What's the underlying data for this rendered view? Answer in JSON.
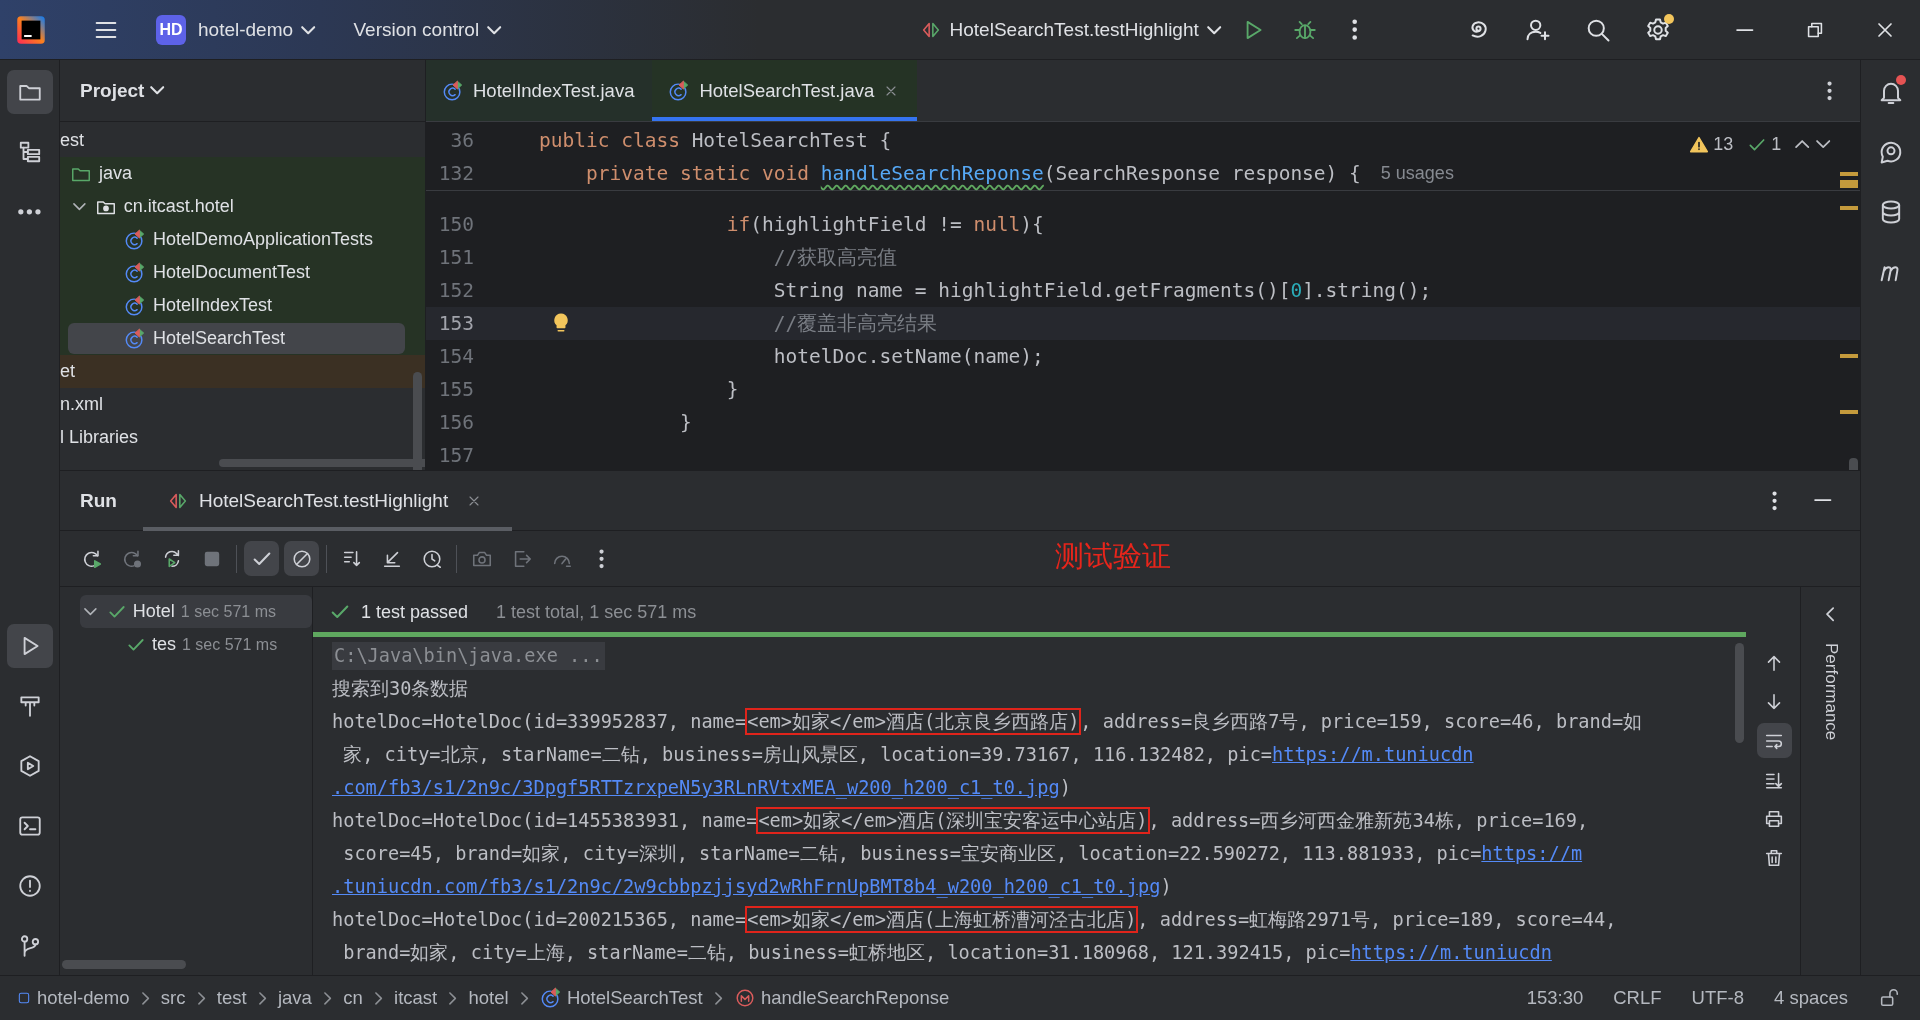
{
  "title_bar": {
    "project_badge": "HD",
    "project": "hotel-demo",
    "vcs": "Version control",
    "run_config": "HotelSearchTest.testHighlight",
    "settings_notice": true
  },
  "tool_strip_left": {
    "top": [
      {
        "kind": "project",
        "selected": true
      },
      {
        "kind": "structure",
        "selected": false
      },
      {
        "kind": "more",
        "selected": false
      }
    ],
    "bottom": [
      {
        "kind": "run",
        "selected": true
      },
      {
        "kind": "build",
        "selected": false
      },
      {
        "kind": "services",
        "selected": false
      },
      {
        "kind": "terminal",
        "selected": false
      },
      {
        "kind": "problems",
        "selected": false
      },
      {
        "kind": "git",
        "selected": false
      }
    ]
  },
  "tool_strip_right": [
    {
      "kind": "notifications",
      "unread": true
    },
    {
      "kind": "ai-chat",
      "unread": false
    },
    {
      "kind": "database",
      "unread": false
    },
    {
      "kind": "maven",
      "unread": false
    }
  ],
  "project_panel": {
    "title": "Project",
    "tree": [
      {
        "label": "est",
        "test_scope": false,
        "excluded": false,
        "selected": false,
        "children": [
          {
            "label": "java",
            "kind": "source-folder",
            "test_scope": true,
            "excluded": false,
            "selected": false,
            "children": [
              {
                "label": "cn.itcast.hotel",
                "kind": "package",
                "expanded": true,
                "test_scope": true,
                "excluded": false,
                "selected": false,
                "children": [
                  {
                    "label": "HotelDemoApplicationTests",
                    "kind": "test-class",
                    "test_scope": true,
                    "excluded": false,
                    "selected": false
                  },
                  {
                    "label": "HotelDocumentTest",
                    "kind": "test-class",
                    "test_scope": true,
                    "excluded": false,
                    "selected": false
                  },
                  {
                    "label": "HotelIndexTest",
                    "kind": "test-class",
                    "test_scope": true,
                    "excluded": false,
                    "selected": false
                  },
                  {
                    "label": "HotelSearchTest",
                    "kind": "test-class",
                    "test_scope": true,
                    "excluded": false,
                    "selected": true
                  }
                ]
              }
            ]
          }
        ]
      },
      {
        "label": "et",
        "test_scope": false,
        "excluded": true,
        "selected": false
      },
      {
        "label": "n.xml",
        "test_scope": false,
        "excluded": false,
        "selected": false
      },
      {
        "label": "l Libraries",
        "test_scope": false,
        "excluded": false,
        "selected": false
      }
    ]
  },
  "editor": {
    "tabs": [
      {
        "label": "HotelIndexTest.java",
        "selected": false
      },
      {
        "label": "HotelSearchTest.java",
        "selected": true
      }
    ],
    "inspections": {
      "warnings": "13",
      "passed": "1"
    },
    "sticky_lines": [
      {
        "number": "36",
        "tokens": [
          {
            "kind": "keyword",
            "text": "public class "
          },
          {
            "kind": "plain",
            "text": "HotelSearchTest {"
          }
        ]
      },
      {
        "number": "132",
        "tokens": [
          {
            "kind": "keyword",
            "text": "    private static void "
          },
          {
            "kind": "misspelled-method",
            "text": "handleSearchReponse"
          },
          {
            "kind": "plain",
            "text": "(SearchResponse response) {"
          }
        ],
        "hint": "5 usages"
      }
    ],
    "lines": [
      {
        "number": "150",
        "current": false,
        "tokens": [
          {
            "kind": "keyword",
            "text": "                if"
          },
          {
            "kind": "plain",
            "text": "(highlightField != "
          },
          {
            "kind": "keyword",
            "text": "null"
          },
          {
            "kind": "plain",
            "text": "){"
          }
        ]
      },
      {
        "number": "151",
        "current": false,
        "tokens": [
          {
            "kind": "comment",
            "text": "                    //获取高亮值"
          }
        ]
      },
      {
        "number": "152",
        "current": false,
        "tokens": [
          {
            "kind": "plain",
            "text": "                    String name = highlightField.getFragments()["
          },
          {
            "kind": "number",
            "text": "0"
          },
          {
            "kind": "plain",
            "text": "].string();"
          }
        ]
      },
      {
        "number": "153",
        "current": true,
        "tokens": [
          {
            "kind": "comment",
            "text": "                    //覆盖非高亮结果"
          }
        ]
      },
      {
        "number": "154",
        "current": false,
        "tokens": [
          {
            "kind": "plain",
            "text": "                    hotelDoc.setName(name);"
          }
        ]
      },
      {
        "number": "155",
        "current": false,
        "tokens": [
          {
            "kind": "plain",
            "text": "                }"
          }
        ]
      },
      {
        "number": "156",
        "current": false,
        "tokens": [
          {
            "kind": "plain",
            "text": "            }"
          }
        ]
      },
      {
        "number": "157",
        "current": false
      }
    ]
  },
  "run_panel": {
    "title": "Run",
    "tab": "HotelSearchTest.testHighlight",
    "annotation": "测试验证",
    "toolbar_groups": [
      {
        "items": [
          {
            "kind": "rerun",
            "on": false,
            "disabled": false
          },
          {
            "kind": "rerun-failed",
            "on": false,
            "disabled": true
          },
          {
            "kind": "auto-rerun",
            "on": false,
            "disabled": false
          },
          {
            "kind": "stop",
            "on": false,
            "disabled": true
          }
        ]
      },
      {
        "items": [
          {
            "kind": "show-passed",
            "on": true,
            "disabled": false
          },
          {
            "kind": "show-ignored",
            "on": true,
            "disabled": false
          }
        ]
      },
      {
        "items": [
          {
            "kind": "sort",
            "on": false,
            "disabled": false
          },
          {
            "kind": "collapse",
            "on": false,
            "disabled": false
          },
          {
            "kind": "history",
            "on": false,
            "disabled": false
          }
        ]
      },
      {
        "items": [
          {
            "kind": "snapshot",
            "on": false,
            "disabled": true
          },
          {
            "kind": "export",
            "on": false,
            "disabled": true
          },
          {
            "kind": "profile",
            "on": false,
            "disabled": true
          },
          {
            "kind": "more",
            "on": false,
            "disabled": false
          }
        ]
      }
    ],
    "tests": [
      {
        "label": "Hotel",
        "time": "1 sec 571 ms",
        "passed": true,
        "selected": true,
        "expanded": true,
        "children": [
          {
            "label": "tes",
            "time": "1 sec 571 ms",
            "passed": true,
            "selected": false
          }
        ]
      }
    ],
    "summary": {
      "status": "1 test passed",
      "details": "1 test total, 1 sec 571 ms",
      "passed": true,
      "level": 1
    },
    "console": [
      {
        "kind": "command",
        "text": "C:\\Java\\bin\\java.exe ..."
      },
      {
        "kind": "output",
        "parts": [
          {
            "kind": "text",
            "text": "搜索到30条数据"
          }
        ]
      },
      {
        "kind": "output",
        "parts": [
          {
            "kind": "text",
            "text": "hotelDoc=HotelDoc(id=339952837, name="
          },
          {
            "kind": "boxed",
            "text": "<em>如家</em>酒店(北京良乡西路店)"
          },
          {
            "kind": "text",
            "text": ", address=良乡西路7号, price=159, score=46, brand=如"
          }
        ]
      },
      {
        "kind": "output",
        "parts": [
          {
            "kind": "text",
            "text": " 家, city=北京, starName=二钻, business=房山风景区, location=39.73167, 116.132482, pic="
          },
          {
            "kind": "link",
            "text": "https://m.tuniucdn"
          }
        ]
      },
      {
        "kind": "output",
        "parts": [
          {
            "kind": "link",
            "text": ".com/fb3/s1/2n9c/3Dpgf5RTTzrxpeN5y3RLnRVtxMEA_w200_h200_c1_t0.jpg"
          },
          {
            "kind": "text",
            "text": ")"
          }
        ]
      },
      {
        "kind": "output",
        "parts": [
          {
            "kind": "text",
            "text": "hotelDoc=HotelDoc(id=1455383931, name="
          },
          {
            "kind": "boxed",
            "text": "<em>如家</em>酒店(深圳宝安客运中心站店)"
          },
          {
            "kind": "text",
            "text": ", address=西乡河西金雅新苑34栋, price=169,"
          }
        ]
      },
      {
        "kind": "output",
        "parts": [
          {
            "kind": "text",
            "text": " score=45, brand=如家, city=深圳, starName=二钻, business=宝安商业区, location=22.590272, 113.881933, pic="
          },
          {
            "kind": "link",
            "text": "https://m"
          }
        ]
      },
      {
        "kind": "output",
        "parts": [
          {
            "kind": "link",
            "text": ".tuniucdn.com/fb3/s1/2n9c/2w9cbbpzjjsyd2wRhFrnUpBMT8b4_w200_h200_c1_t0.jpg"
          },
          {
            "kind": "text",
            "text": ")"
          }
        ]
      },
      {
        "kind": "output",
        "parts": [
          {
            "kind": "text",
            "text": "hotelDoc=HotelDoc(id=200215365, name="
          },
          {
            "kind": "boxed",
            "text": "<em>如家</em>酒店(上海虹桥漕河泾古北店)"
          },
          {
            "kind": "text",
            "text": ", address=虹梅路2971号, price=189, score=44,"
          }
        ]
      },
      {
        "kind": "output",
        "parts": [
          {
            "kind": "text",
            "text": " brand=如家, city=上海, starName=二钻, business=虹桥地区, location=31.180968, 121.392415, pic="
          },
          {
            "kind": "link",
            "text": "https://m.tuniucdn"
          }
        ]
      }
    ],
    "console_tools": [
      {
        "kind": "up",
        "on": false
      },
      {
        "kind": "down",
        "on": false
      },
      {
        "kind": "soft-wrap",
        "on": true
      },
      {
        "kind": "scroll-end",
        "on": false
      },
      {
        "kind": "print",
        "on": false
      },
      {
        "kind": "clear",
        "on": false
      }
    ],
    "side_tab": "Performance"
  },
  "status_bar": {
    "breadcrumbs": [
      {
        "kind": "module",
        "text": "hotel-demo"
      },
      {
        "kind": "folder",
        "text": "src"
      },
      {
        "kind": "folder",
        "text": "test"
      },
      {
        "kind": "folder",
        "text": "java"
      },
      {
        "kind": "folder",
        "text": "cn"
      },
      {
        "kind": "folder",
        "text": "itcast"
      },
      {
        "kind": "folder",
        "text": "hotel"
      },
      {
        "kind": "class",
        "text": "HotelSearchTest"
      },
      {
        "kind": "method",
        "text": "handleSearchReponse"
      }
    ],
    "position": "153:30",
    "line_ending": "CRLF",
    "encoding": "UTF-8",
    "indent": "4 spaces"
  }
}
